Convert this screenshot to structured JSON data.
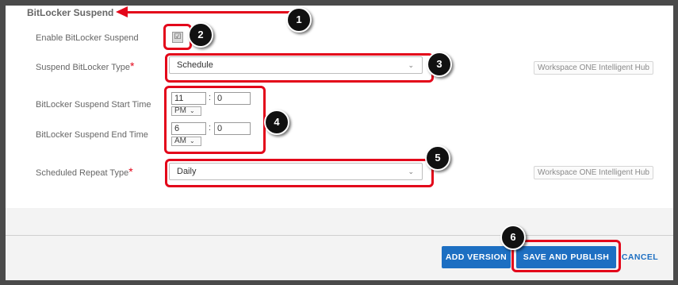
{
  "section": {
    "title": "BitLocker Suspend"
  },
  "fields": {
    "enable_label": "Enable BitLocker Suspend",
    "enable_checked_glyph": "☑",
    "type_label": "Suspend BitLocker Type",
    "type_value": "Schedule",
    "start_label": "BitLocker Suspend Start Time",
    "start_hour": "11",
    "start_minute": "0",
    "start_ampm": "PM",
    "end_label": "BitLocker Suspend End Time",
    "end_hour": "6",
    "end_minute": "0",
    "end_ampm": "AM",
    "repeat_label": "Scheduled Repeat Type",
    "repeat_value": "Daily",
    "required_mark": "*",
    "time_separator": ":",
    "chevron": "⌄"
  },
  "tags": {
    "hub_1": "Workspace ONE Intelligent Hub",
    "hub_2": "Workspace ONE Intelligent Hub"
  },
  "buttons": {
    "add_version": "ADD VERSION",
    "save_publish": "SAVE AND PUBLISH",
    "cancel": "CANCEL"
  },
  "callouts": [
    "1",
    "2",
    "3",
    "4",
    "5",
    "6"
  ],
  "colors": {
    "annotation_red": "#e3061a",
    "primary_blue": "#1d6fc2",
    "frame": "#4a4a4a"
  }
}
